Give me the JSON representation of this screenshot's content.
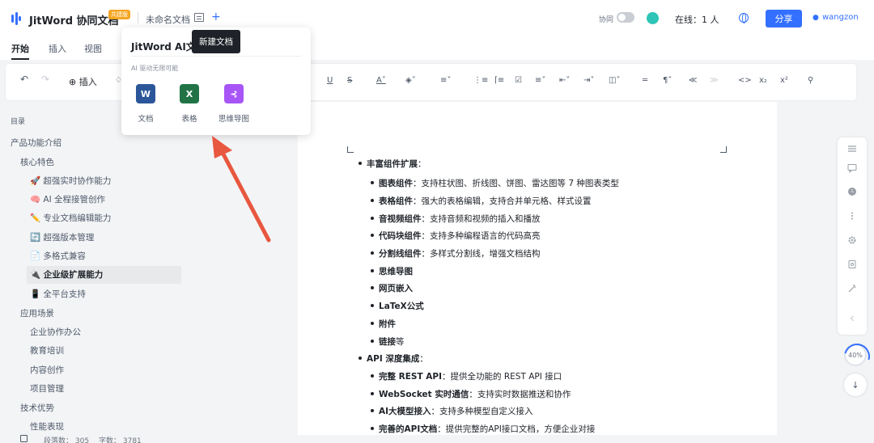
{
  "header": {
    "app_title": "JitWord 协同文档",
    "badge": "共建版",
    "doc_name": "未命名文档",
    "add_symbol": "+",
    "collab_label": "协同",
    "online": "在线：1 人",
    "share_label": "分享",
    "user_name": "wangzon"
  },
  "tabs": [
    "开始",
    "插入",
    "视图"
  ],
  "toolbar": {
    "insert_label": "⊕ 插入"
  },
  "sidebar": {
    "title": "目录",
    "items": [
      {
        "label": "产品功能介绍"
      },
      {
        "label": "核心特色"
      },
      {
        "label": "🚀 超强实时协作能力"
      },
      {
        "label": "🧠 AI 全程接管创作"
      },
      {
        "label": "✏️ 专业文档编辑能力"
      },
      {
        "label": "🔄 超强版本管理"
      },
      {
        "label": "📄 多格式兼容"
      },
      {
        "label": "🔌 企业级扩展能力"
      },
      {
        "label": "📱 全平台支持"
      },
      {
        "label": "应用场景"
      },
      {
        "label": "企业协作办公"
      },
      {
        "label": "教育培训"
      },
      {
        "label": "内容创作"
      },
      {
        "label": "项目管理"
      },
      {
        "label": "技术优势"
      },
      {
        "label": "性能表现"
      }
    ],
    "active_index": 7
  },
  "document": {
    "lines": [
      {
        "bold": "丰富组件扩展",
        "text": "："
      },
      {
        "bold": "图表组件",
        "text": "：支持柱状图、折线图、饼图、雷达图等 7 种图表类型"
      },
      {
        "bold": "表格组件",
        "text": "：强大的表格编辑，支持合并单元格、样式设置"
      },
      {
        "bold": "音视频组件",
        "text": "：支持音频和视频的插入和播放"
      },
      {
        "bold": "代码块组件",
        "text": "：支持多种编程语言的代码高亮"
      },
      {
        "bold": "分割线组件",
        "text": "：多样式分割线，增强文档结构"
      },
      {
        "bold": "思维导图",
        "text": ""
      },
      {
        "bold": "网页嵌入",
        "text": ""
      },
      {
        "bold": "LaTeX公式",
        "text": ""
      },
      {
        "bold": "附件",
        "text": ""
      },
      {
        "bold": "链接",
        "text": "等"
      },
      {
        "bold": "API 深度集成",
        "text": "："
      },
      {
        "bold": "完整 REST API",
        "text": "：提供全功能的 REST API 接口"
      },
      {
        "bold": "WebSocket 实时通信",
        "text": "：支持实时数据推送和协作"
      },
      {
        "bold": "AI大模型接入",
        "text": "：支持多种模型自定义接入"
      },
      {
        "bold": "完善的API文档",
        "text": "：提供完整的API接口文档，方便企业对接"
      }
    ]
  },
  "popover": {
    "title": "JitWord AI文档",
    "subtitle": "AI 驱动无限可能",
    "apps": [
      {
        "label": "文档",
        "glyph": "W",
        "color": "#2b579a"
      },
      {
        "label": "表格",
        "glyph": "X",
        "color": "#217346"
      },
      {
        "label": "思维导图",
        "glyph": "⊰",
        "color": "#a855f7"
      }
    ]
  },
  "tooltip": "新建文档",
  "zoom": "40%",
  "status": {
    "paragraphs": "段落数：  305",
    "words": "字数：  3781"
  },
  "colors": {
    "accent": "#3370ff",
    "arrow": "#e8573f"
  }
}
